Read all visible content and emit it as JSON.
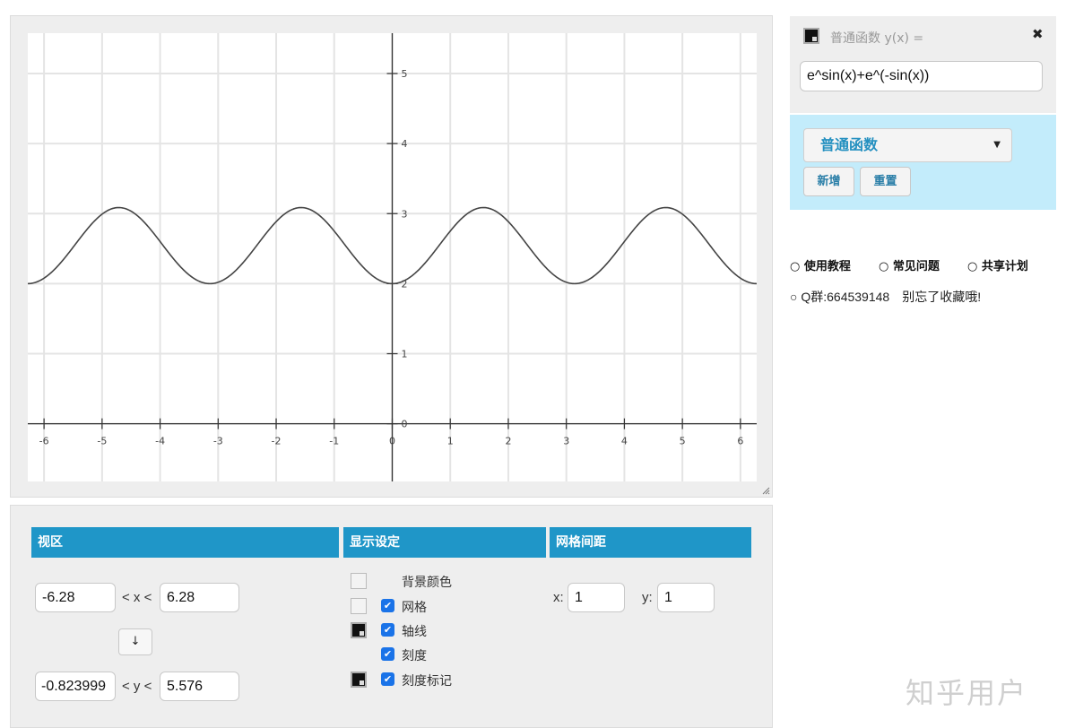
{
  "function_panel": {
    "label": "普通函数 y(x) =",
    "close_icon": "✖",
    "expression": "e^sin(x)+e^(-sin(x))",
    "color": "#000000"
  },
  "add_panel": {
    "type_selected": "普通函数",
    "add_button": "新增",
    "reset_button": "重置"
  },
  "links": {
    "tutorial": "○ 使用教程",
    "faq": "○ 常见问题",
    "share": "○ 共享计划",
    "qq": "○ Q群:664539148　别忘了收藏哦!"
  },
  "watermark": "知乎用户",
  "settings": {
    "viewport": {
      "title": "视区",
      "xmin": "-6.28",
      "xmax": "6.28",
      "x_sep": "< x <",
      "ymin": "-0.823999",
      "ymax": "5.576",
      "y_sep": "< y <",
      "swap_icon": "↓"
    },
    "display": {
      "title": "显示设定",
      "background": "背景颜色",
      "grid": "网格",
      "axes": "轴线",
      "ticks": "刻度",
      "tick_labels": "刻度标记"
    },
    "grid_spacing": {
      "title": "网格间距",
      "x_label": "x:",
      "x_value": "1",
      "y_label": "y:",
      "y_value": "1"
    }
  },
  "chart_data": {
    "type": "line",
    "title": "",
    "xlabel": "",
    "ylabel": "",
    "function": "e^sin(x)+e^(-sin(x))",
    "xlim": [
      -6.28,
      6.28
    ],
    "ylim": [
      -0.823999,
      5.576
    ],
    "grid": true,
    "x_ticks": [
      "-6",
      "-5",
      "-4",
      "-3",
      "-2",
      "-1",
      "0",
      "1",
      "2",
      "3",
      "4",
      "5",
      "6"
    ],
    "y_ticks": [
      "0",
      "1",
      "2",
      "3",
      "4",
      "5"
    ],
    "line_color": "#444444",
    "grid_color": "#e4e4e4",
    "axis_color": "#333333"
  }
}
